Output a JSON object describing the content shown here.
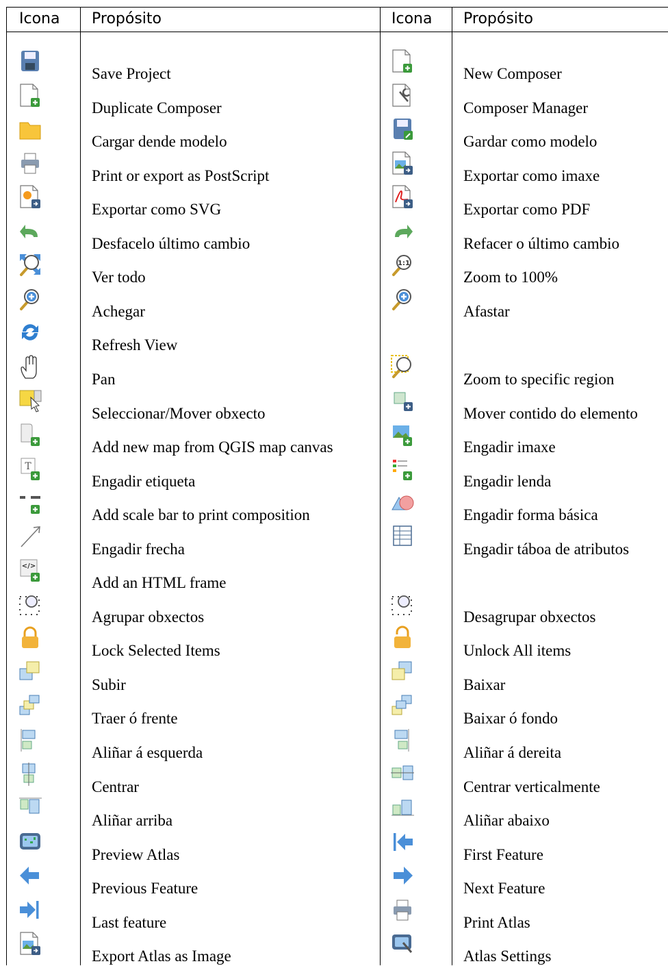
{
  "headers": [
    "Icona",
    "Propósito",
    "Icona",
    "Propósito"
  ],
  "rows": [
    {
      "left": {
        "icon": "save-project-icon",
        "label": "Save Project"
      },
      "right": {
        "icon": "new-composer-icon",
        "label": "New Composer"
      }
    },
    {
      "left": {
        "icon": "duplicate-composer-icon",
        "label": "Duplicate Composer"
      },
      "right": {
        "icon": "composer-manager-icon",
        "label": "Composer Manager"
      }
    },
    {
      "left": {
        "icon": "folder-open-icon",
        "label": "Cargar dende modelo"
      },
      "right": {
        "icon": "save-as-template-icon",
        "label": "Gardar como modelo"
      }
    },
    {
      "left": {
        "icon": "printer-icon",
        "label": "Print or export as PostScript"
      },
      "right": {
        "icon": "export-image-icon",
        "label": "Exportar como imaxe"
      }
    },
    {
      "left": {
        "icon": "export-svg-icon",
        "label": "Exportar como SVG"
      },
      "right": {
        "icon": "export-pdf-icon",
        "label": "Exportar como PDF"
      }
    },
    {
      "left": {
        "icon": "undo-icon",
        "label": "Desfacelo último cambio"
      },
      "right": {
        "icon": "redo-icon",
        "label": "Refacer o último cambio"
      }
    },
    {
      "left": {
        "icon": "zoom-full-icon",
        "label": "Ver todo"
      },
      "right": {
        "icon": "zoom-actual-icon",
        "label": "Zoom to 100%"
      }
    },
    {
      "left": {
        "icon": "zoom-in-icon",
        "label": "Achegar"
      },
      "right": {
        "icon": "zoom-out-icon",
        "label": "Afastar"
      }
    },
    {
      "left": {
        "icon": "refresh-icon",
        "label": "Refresh View"
      },
      "right": {
        "icon": "",
        "label": ""
      }
    },
    {
      "left": {
        "icon": "pan-hand-icon",
        "label": "Pan"
      },
      "right": {
        "icon": "zoom-region-icon",
        "label": "Zoom to specific region"
      }
    },
    {
      "left": {
        "icon": "select-move-icon",
        "label": "Seleccionar/Mover obxecto"
      },
      "right": {
        "icon": "move-content-icon",
        "label": "Mover contido do elemento"
      }
    },
    {
      "left": {
        "icon": "add-map-icon",
        "label": "Add new map from QGIS map canvas"
      },
      "right": {
        "icon": "add-image-icon",
        "label": "Engadir imaxe"
      }
    },
    {
      "left": {
        "icon": "add-label-icon",
        "label": "Engadir etiqueta"
      },
      "right": {
        "icon": "add-legend-icon",
        "label": "Engadir lenda"
      }
    },
    {
      "left": {
        "icon": "add-scalebar-icon",
        "label": "Add scale bar to print composition"
      },
      "right": {
        "icon": "add-shape-icon",
        "label": "Engadir forma básica"
      }
    },
    {
      "left": {
        "icon": "add-arrow-icon",
        "label": "Engadir frecha"
      },
      "right": {
        "icon": "add-table-icon",
        "label": "Engadir táboa de atributos"
      }
    },
    {
      "left": {
        "icon": "add-html-icon",
        "label": "Add an HTML frame"
      },
      "right": {
        "icon": "",
        "label": ""
      }
    },
    {
      "left": {
        "icon": "group-items-icon",
        "label": "Agrupar obxectos"
      },
      "right": {
        "icon": "ungroup-items-icon",
        "label": "Desagrupar obxectos"
      }
    },
    {
      "left": {
        "icon": "lock-icon",
        "label": "Lock Selected Items"
      },
      "right": {
        "icon": "unlock-icon",
        "label": "Unlock All items"
      }
    },
    {
      "left": {
        "icon": "raise-icon",
        "label": "Subir"
      },
      "right": {
        "icon": "lower-icon",
        "label": "Baixar"
      }
    },
    {
      "left": {
        "icon": "bring-front-icon",
        "label": "Traer ó frente"
      },
      "right": {
        "icon": "send-back-icon",
        "label": "Baixar ó fondo"
      }
    },
    {
      "left": {
        "icon": "align-left-icon",
        "label": "Aliñar á esquerda"
      },
      "right": {
        "icon": "align-right-icon",
        "label": "Aliñar á dereita"
      }
    },
    {
      "left": {
        "icon": "align-hcenter-icon",
        "label": "Centrar"
      },
      "right": {
        "icon": "align-vcenter-icon",
        "label": "Centrar verticalmente"
      }
    },
    {
      "left": {
        "icon": "align-top-icon",
        "label": "Aliñar arriba"
      },
      "right": {
        "icon": "align-bottom-icon",
        "label": "Aliñar abaixo"
      }
    },
    {
      "left": {
        "icon": "atlas-preview-icon",
        "label": "Preview Atlas"
      },
      "right": {
        "icon": "first-feature-icon",
        "label": "First Feature"
      }
    },
    {
      "left": {
        "icon": "previous-feature-icon",
        "label": "Previous Feature"
      },
      "right": {
        "icon": "next-feature-icon",
        "label": "Next Feature"
      }
    },
    {
      "left": {
        "icon": "last-feature-icon",
        "label": "Last feature"
      },
      "right": {
        "icon": "print-atlas-icon",
        "label": "Print Atlas"
      }
    },
    {
      "left": {
        "icon": "export-atlas-image-icon",
        "label": "Export Atlas as Image"
      },
      "right": {
        "icon": "atlas-settings-icon",
        "label": "Atlas Settings"
      }
    }
  ]
}
